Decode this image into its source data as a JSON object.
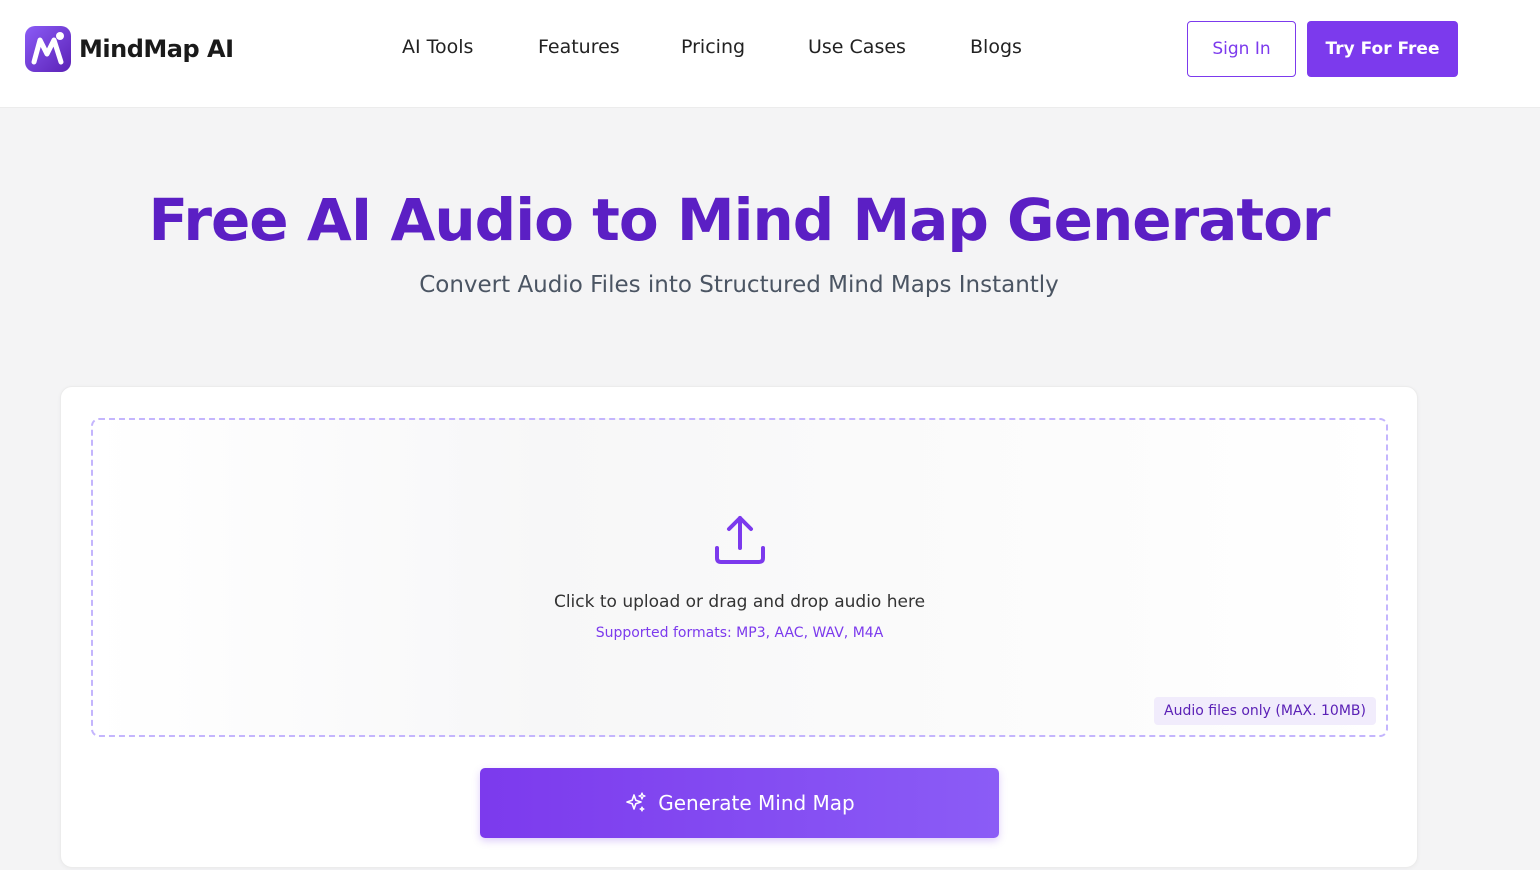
{
  "brand": {
    "name": "MindMap AI",
    "logo_icon": "mindmap-logo-icon",
    "accent_color": "#7c3aed",
    "title_color": "#5b1fc4"
  },
  "nav": {
    "items": [
      {
        "label": "AI Tools"
      },
      {
        "label": "Features"
      },
      {
        "label": "Pricing"
      },
      {
        "label": "Use Cases"
      },
      {
        "label": "Blogs"
      }
    ]
  },
  "header": {
    "signin_label": "Sign In",
    "try_label": "Try For Free"
  },
  "hero": {
    "title": "Free AI Audio to Mind Map Generator",
    "subtitle": "Convert Audio Files into Structured Mind Maps Instantly"
  },
  "upload": {
    "icon": "upload-icon",
    "prompt": "Click to upload or drag and drop audio here",
    "formats": "Supported formats: MP3, AAC, WAV, M4A",
    "limit_badge": "Audio files only (MAX. 10MB)"
  },
  "generate": {
    "icon": "sparkles-icon",
    "label": "Generate Mind Map"
  }
}
